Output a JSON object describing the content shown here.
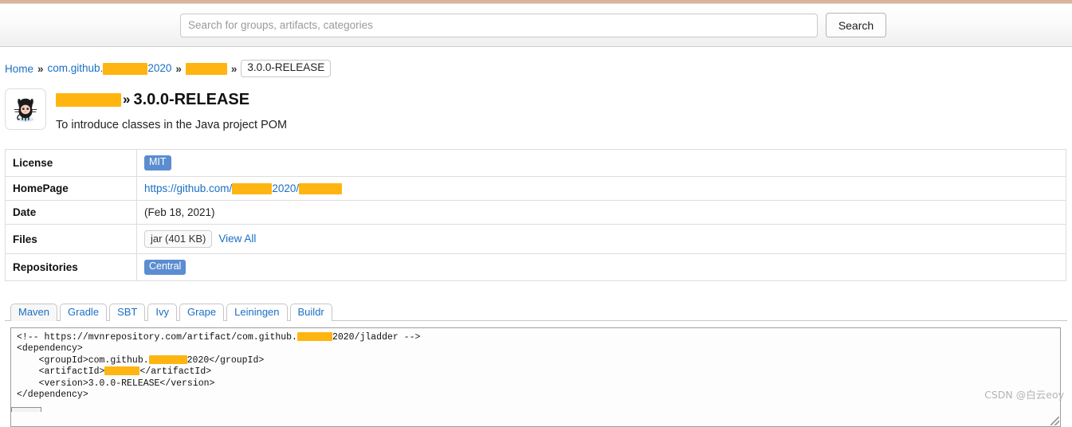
{
  "header": {
    "search": {
      "placeholder": "Search for groups, artifacts, categories",
      "value": "",
      "button_label": "Search"
    }
  },
  "breadcrumb": {
    "items": [
      {
        "label": "Home",
        "type": "link"
      },
      {
        "label": "com.github.",
        "type": "link",
        "redacted_after": true,
        "label_suffix": "2020"
      },
      {
        "label": "",
        "type": "link",
        "redacted": true
      },
      {
        "label": "3.0.0-RELEASE",
        "type": "current"
      }
    ],
    "separator": "»"
  },
  "artifact": {
    "logo_icon": "github-octocat-icon",
    "name_redacted": true,
    "separator": "»",
    "version": "3.0.0-RELEASE",
    "description": "To introduce classes in the Java project POM"
  },
  "info_table": {
    "rows": [
      {
        "label": "License",
        "value_type": "badge",
        "value": "MIT"
      },
      {
        "label": "HomePage",
        "value_type": "link",
        "value_prefix": "https://github.com/",
        "value_mid": "2020/",
        "value_redacted": true
      },
      {
        "label": "Date",
        "value_type": "text",
        "value": "(Feb 18, 2021)"
      },
      {
        "label": "Files",
        "value_type": "files",
        "chip": "jar (401 KB)",
        "view_all": "View All"
      },
      {
        "label": "Repositories",
        "value_type": "badge",
        "value": "Central"
      }
    ]
  },
  "tabs": {
    "items": [
      "Maven",
      "Gradle",
      "SBT",
      "Ivy",
      "Grape",
      "Leiningen",
      "Buildr"
    ],
    "active": "Maven"
  },
  "code": {
    "line1_prefix": "<!-- https://mvnrepository.com/artifact/com.github.",
    "line1_mid": "2020/jladder -->",
    "line2": "<dependency>",
    "line3_prefix": "    <groupId>com.github.",
    "line3_suffix": "2020</groupId>",
    "line4_prefix": "    <artifactId>",
    "line4_suffix": "</artifactId>",
    "line5": "    <version>3.0.0-RELEASE</version>",
    "line6": "</dependency>"
  },
  "watermark": {
    "text": "CSDN @白云eoy"
  },
  "colors": {
    "link": "#1a6fc4",
    "badge": "#5b8dd0",
    "redaction": "#ffb511",
    "top_strip": "#d9b39c"
  }
}
